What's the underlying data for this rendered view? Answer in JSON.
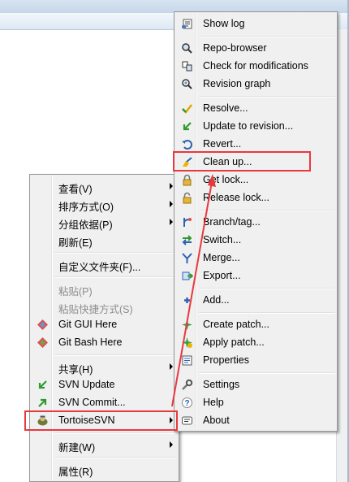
{
  "left_menu": {
    "items": [
      {
        "label": "查看(V)",
        "submenu": true
      },
      {
        "label": "排序方式(O)",
        "submenu": true
      },
      {
        "label": "分组依据(P)",
        "submenu": true
      },
      {
        "label": "刷新(E)"
      },
      {
        "label": "自定义文件夹(F)..."
      },
      {
        "label": "粘贴(P)",
        "disabled": true
      },
      {
        "label": "粘贴快捷方式(S)",
        "disabled": true
      },
      {
        "label": "Git GUI Here",
        "icon": "git-gui-icon"
      },
      {
        "label": "Git Bash Here",
        "icon": "git-bash-icon"
      },
      {
        "label": "共享(H)",
        "submenu": true
      },
      {
        "label": "SVN Update",
        "icon": "svn-update-icon"
      },
      {
        "label": "SVN Commit...",
        "icon": "svn-commit-icon"
      },
      {
        "label": "TortoiseSVN",
        "icon": "tortoisesvn-icon",
        "submenu": true,
        "highlighted": true
      },
      {
        "label": "新建(W)",
        "submenu": true
      },
      {
        "label": "属性(R)"
      }
    ]
  },
  "right_menu": {
    "items": [
      {
        "label": "Show log",
        "icon": "show-log-icon"
      },
      {
        "label": "Repo-browser",
        "icon": "repo-browser-icon"
      },
      {
        "label": "Check for modifications",
        "icon": "check-modifications-icon"
      },
      {
        "label": "Revision graph",
        "icon": "revision-graph-icon"
      },
      {
        "label": "Resolve...",
        "icon": "resolve-icon"
      },
      {
        "label": "Update to revision...",
        "icon": "update-to-revision-icon"
      },
      {
        "label": "Revert...",
        "icon": "revert-icon"
      },
      {
        "label": "Clean up...",
        "icon": "clean-up-icon",
        "highlighted": true
      },
      {
        "label": "Get lock...",
        "icon": "lock-icon"
      },
      {
        "label": "Release lock...",
        "icon": "unlock-icon"
      },
      {
        "label": "Branch/tag...",
        "icon": "branch-tag-icon"
      },
      {
        "label": "Switch...",
        "icon": "switch-icon"
      },
      {
        "label": "Merge...",
        "icon": "merge-icon"
      },
      {
        "label": "Export...",
        "icon": "export-icon"
      },
      {
        "label": "Add...",
        "icon": "add-icon"
      },
      {
        "label": "Create patch...",
        "icon": "create-patch-icon"
      },
      {
        "label": "Apply patch...",
        "icon": "apply-patch-icon"
      },
      {
        "label": "Properties",
        "icon": "properties-icon"
      },
      {
        "label": "Settings",
        "icon": "settings-icon"
      },
      {
        "label": "Help",
        "icon": "help-icon"
      },
      {
        "label": "About",
        "icon": "about-icon"
      }
    ]
  },
  "colors": {
    "menu_bg": "#f0f0f0",
    "highlight_border": "#e8393f",
    "arrow": "#e8393f",
    "disabled_text": "#8d8d8d"
  }
}
